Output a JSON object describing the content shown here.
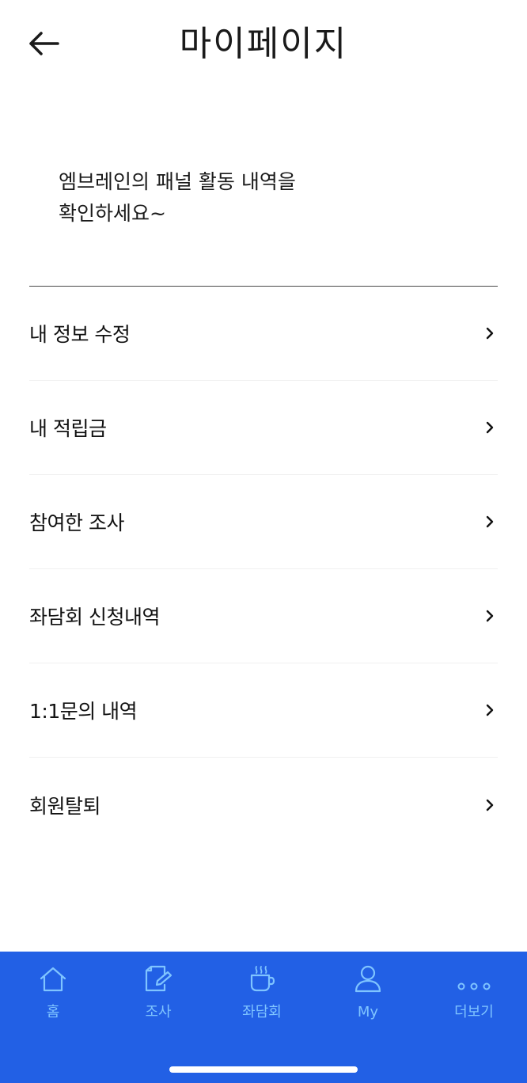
{
  "header": {
    "title": "마이페이지",
    "back_icon": "arrow-left-icon"
  },
  "greeting": {
    "line1": "엠브레인의 패널 활동 내역을",
    "line2": "확인하세요~"
  },
  "menu": {
    "items": [
      {
        "label": "내 정보 수정",
        "icon": "chevron-right-icon"
      },
      {
        "label": "내 적립금",
        "icon": "chevron-right-icon"
      },
      {
        "label": "참여한 조사",
        "icon": "chevron-right-icon"
      },
      {
        "label": "좌담회 신청내역",
        "icon": "chevron-right-icon"
      },
      {
        "label": "1:1문의 내역",
        "icon": "chevron-right-icon"
      },
      {
        "label": "회원탈퇴",
        "icon": "chevron-right-icon"
      }
    ]
  },
  "tabbar": {
    "background": "#2260e5",
    "accent": "#7fc4ff",
    "tabs": [
      {
        "label": "홈",
        "icon": "home-icon"
      },
      {
        "label": "조사",
        "icon": "survey-edit-icon"
      },
      {
        "label": "좌담회",
        "icon": "coffee-cup-icon"
      },
      {
        "label": "My",
        "icon": "user-icon"
      },
      {
        "label": "더보기",
        "icon": "more-dots-icon"
      }
    ]
  }
}
